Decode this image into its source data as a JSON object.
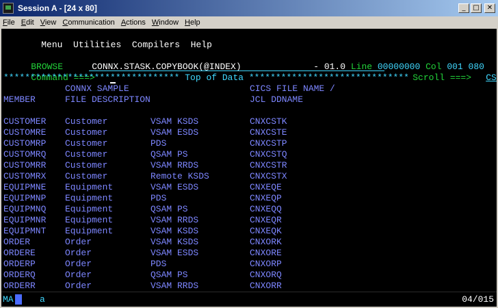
{
  "window": {
    "title": "Session A - [24 x 80]",
    "min_glyph": "_",
    "max_glyph": "□",
    "close_glyph": "✕"
  },
  "menubar": [
    "File",
    "Edit",
    "View",
    "Communication",
    "Actions",
    "Window",
    "Help"
  ],
  "terminal": {
    "top_menu": [
      "Menu",
      "Utilities",
      "Compilers",
      "Help"
    ],
    "browse_label": "BROWSE",
    "dataset": "CONNX.STASK.COPYBOOK(@INDEX)",
    "version": "- 01.0",
    "line_label": "Line",
    "line_value": "00000000",
    "col_label": "Col",
    "col_value": "001 080",
    "command_label": "Command ===>",
    "command_value": "",
    "scroll_label": "Scroll ===>",
    "scroll_value": "CSR",
    "top_of_data": "********************************* Top of Data ******************************",
    "header1": {
      "desc": "CONNX SAMPLE",
      "ddname": "CICS FILE NAME /"
    },
    "header2": {
      "member": "MEMBER",
      "desc": "FILE DESCRIPTION",
      "ddname": "JCL DDNAME"
    },
    "rows": [
      {
        "member": "CUSTOMER",
        "desc": "Customer",
        "type": "VSAM KSDS",
        "dd": "CNXCSTK"
      },
      {
        "member": "CUSTOMRE",
        "desc": "Customer",
        "type": "VSAM ESDS",
        "dd": "CNXCSTE"
      },
      {
        "member": "CUSTOMRP",
        "desc": "Customer",
        "type": "PDS",
        "dd": "CNXCSTP"
      },
      {
        "member": "CUSTOMRQ",
        "desc": "Customer",
        "type": "QSAM PS",
        "dd": "CNXCSTQ"
      },
      {
        "member": "CUSTOMRR",
        "desc": "Customer",
        "type": "VSAM RRDS",
        "dd": "CNXCSTR"
      },
      {
        "member": "CUSTOMRX",
        "desc": "Customer",
        "type": "Remote KSDS",
        "dd": "CNXCSTX"
      },
      {
        "member": "EQUIPMNE",
        "desc": "Equipment",
        "type": "VSAM ESDS",
        "dd": "CNXEQE"
      },
      {
        "member": "EQUIPMNP",
        "desc": "Equipment",
        "type": "PDS",
        "dd": "CNXEQP"
      },
      {
        "member": "EQUIPMNQ",
        "desc": "Equipment",
        "type": "QSAM PS",
        "dd": "CNXEQQ"
      },
      {
        "member": "EQUIPMNR",
        "desc": "Equipment",
        "type": "VSAM RRDS",
        "dd": "CNXEQR"
      },
      {
        "member": "EQUIPMNT",
        "desc": "Equipment",
        "type": "VSAM KSDS",
        "dd": "CNXEQK"
      },
      {
        "member": "ORDER",
        "desc": "Order",
        "type": "VSAM KSDS",
        "dd": "CNXORK"
      },
      {
        "member": "ORDERE",
        "desc": "Order",
        "type": "VSAM ESDS",
        "dd": "CNXORE"
      },
      {
        "member": "ORDERP",
        "desc": "Order",
        "type": "PDS",
        "dd": "CNXORP"
      },
      {
        "member": "ORDERQ",
        "desc": "Order",
        "type": "QSAM PS",
        "dd": "CNXORQ"
      },
      {
        "member": "ORDERR",
        "desc": "Order",
        "type": "VSAM RRDS",
        "dd": "CNXORR"
      }
    ]
  },
  "status": {
    "indicator": "MA",
    "field": "a",
    "cursor_pos": "04/015"
  },
  "colors": {
    "title_start": "#0a246a",
    "title_end": "#a6caf0",
    "terminal_bg": "#000000",
    "text_blue": "#7d86ff",
    "text_green": "#22d33a",
    "text_turquoise": "#40d8ff"
  }
}
